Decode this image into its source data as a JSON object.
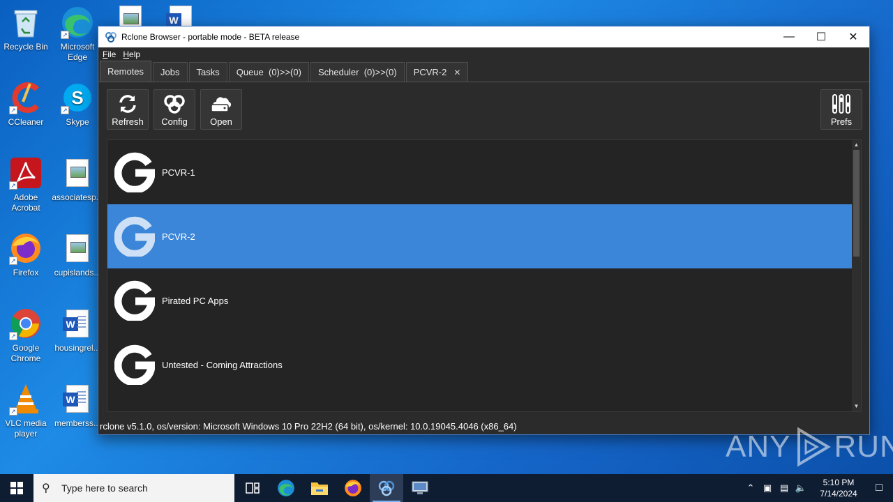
{
  "desktop": {
    "icons": [
      {
        "label": "Recycle Bin",
        "icon": "recycle-bin-icon"
      },
      {
        "label": "Microsoft Edge",
        "icon": "edge-icon"
      },
      {
        "label": "CCleaner",
        "icon": "ccleaner-icon"
      },
      {
        "label": "Skype",
        "icon": "skype-icon"
      },
      {
        "label": "Adobe Acrobat",
        "icon": "acrobat-icon"
      },
      {
        "label": "associatesp...",
        "icon": "image-file-icon"
      },
      {
        "label": "Firefox",
        "icon": "firefox-icon"
      },
      {
        "label": "cupislands...",
        "icon": "image-file-icon"
      },
      {
        "label": "Google Chrome",
        "icon": "chrome-icon"
      },
      {
        "label": "housingrel...",
        "icon": "word-doc-icon"
      },
      {
        "label": "VLC media player",
        "icon": "vlc-icon"
      },
      {
        "label": "memberss...",
        "icon": "word-doc-icon"
      }
    ]
  },
  "window": {
    "title": "Rclone Browser - portable mode - BETA release",
    "menu": [
      "File",
      "Help"
    ],
    "tabs": [
      {
        "label": "Remotes",
        "active": true
      },
      {
        "label": "Jobs"
      },
      {
        "label": "Tasks"
      },
      {
        "label": "Queue  (0)>>(0)"
      },
      {
        "label": "Scheduler  (0)>>(0)"
      },
      {
        "label": "PCVR-2",
        "closable": true
      }
    ],
    "toolbar": {
      "refresh": "Refresh",
      "config": "Config",
      "open": "Open",
      "prefs": "Prefs"
    },
    "remotes": [
      {
        "name": "PCVR-1",
        "icon": "google-drive-g-icon",
        "selected": false
      },
      {
        "name": "PCVR-2",
        "icon": "google-drive-g-icon",
        "selected": true
      },
      {
        "name": "Pirated PC Apps",
        "icon": "google-drive-g-icon",
        "selected": false
      },
      {
        "name": "Untested - Coming Attractions",
        "icon": "google-drive-g-icon",
        "selected": false
      }
    ],
    "status": "rclone v5.1.0, os/version: Microsoft Windows 10 Pro 22H2 (64 bit), os/kernel: 10.0.19045.4046 (x86_64)"
  },
  "watermark": {
    "text_left": "ANY",
    "text_right": "RUN"
  },
  "taskbar": {
    "search_placeholder": "Type here to search",
    "apps": [
      "task-view-icon",
      "edge-icon",
      "file-explorer-icon",
      "firefox-icon",
      "rclone-browser-icon",
      "network-monitor-icon"
    ],
    "time": "5:10 PM",
    "date": "7/14/2024"
  },
  "colors": {
    "selected_row": "#3b86d8",
    "window_bg": "#2b2b2b",
    "desktop_blue": "#1565c8",
    "taskbar": "#0f1d33"
  }
}
